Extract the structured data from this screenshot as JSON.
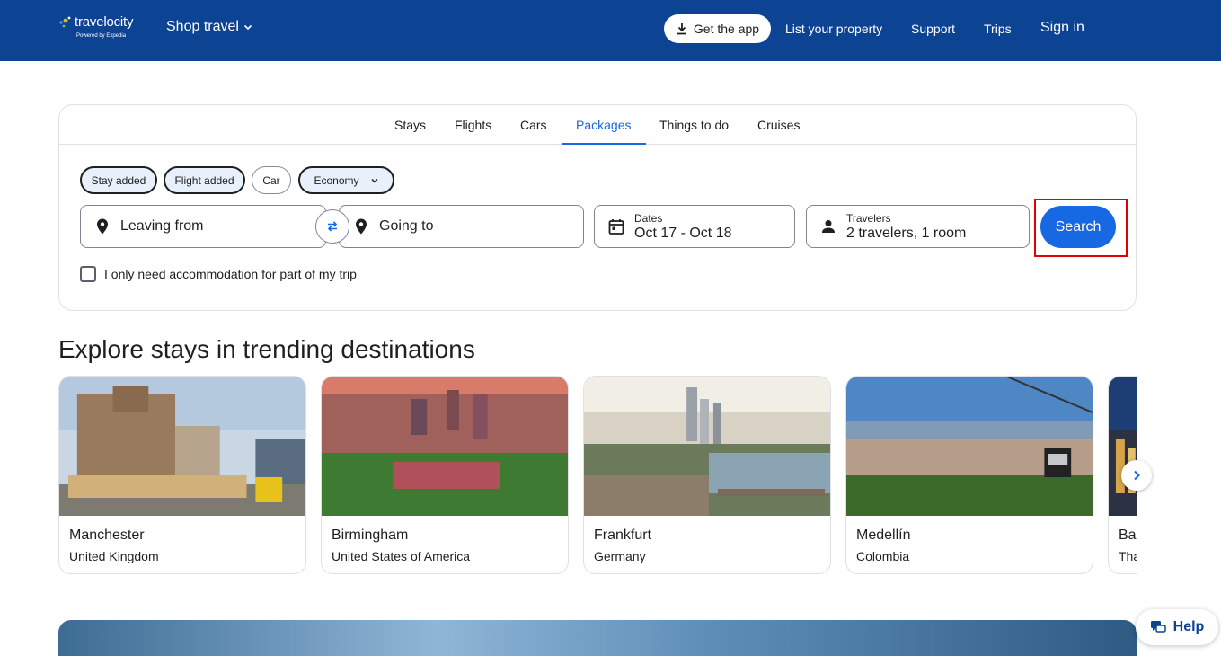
{
  "header": {
    "logo_text": "travelocity",
    "logo_subtext": "Powered by Expedia",
    "shop_travel": "Shop travel",
    "get_app": "Get the app",
    "list_property": "List your property",
    "support": "Support",
    "trips": "Trips",
    "sign_in": "Sign in"
  },
  "tabs": [
    {
      "label": "Stays"
    },
    {
      "label": "Flights"
    },
    {
      "label": "Cars"
    },
    {
      "label": "Packages",
      "active": true
    },
    {
      "label": "Things to do"
    },
    {
      "label": "Cruises"
    }
  ],
  "chips": {
    "stay": "Stay added",
    "flight": "Flight added",
    "car": "Car",
    "cabin": "Economy"
  },
  "search": {
    "leaving_from": "Leaving from",
    "going_to": "Going to",
    "dates_label": "Dates",
    "dates_value": "Oct 17 - Oct 18",
    "travelers_label": "Travelers",
    "travelers_value": "2 travelers, 1 room",
    "search_button": "Search",
    "partial_stay": "I only need accommodation for part of my trip"
  },
  "section": {
    "title": "Explore stays in trending destinations"
  },
  "destinations": [
    {
      "city": "Manchester",
      "country": "United Kingdom"
    },
    {
      "city": "Birmingham",
      "country": "United States of America"
    },
    {
      "city": "Frankfurt",
      "country": "Germany"
    },
    {
      "city": "Medellín",
      "country": "Colombia"
    },
    {
      "city": "Ba",
      "country": "Tha"
    }
  ],
  "help": "Help",
  "colors": {
    "header_bg": "#0c4393",
    "accent": "#1668e3",
    "highlight": "#e00000"
  }
}
